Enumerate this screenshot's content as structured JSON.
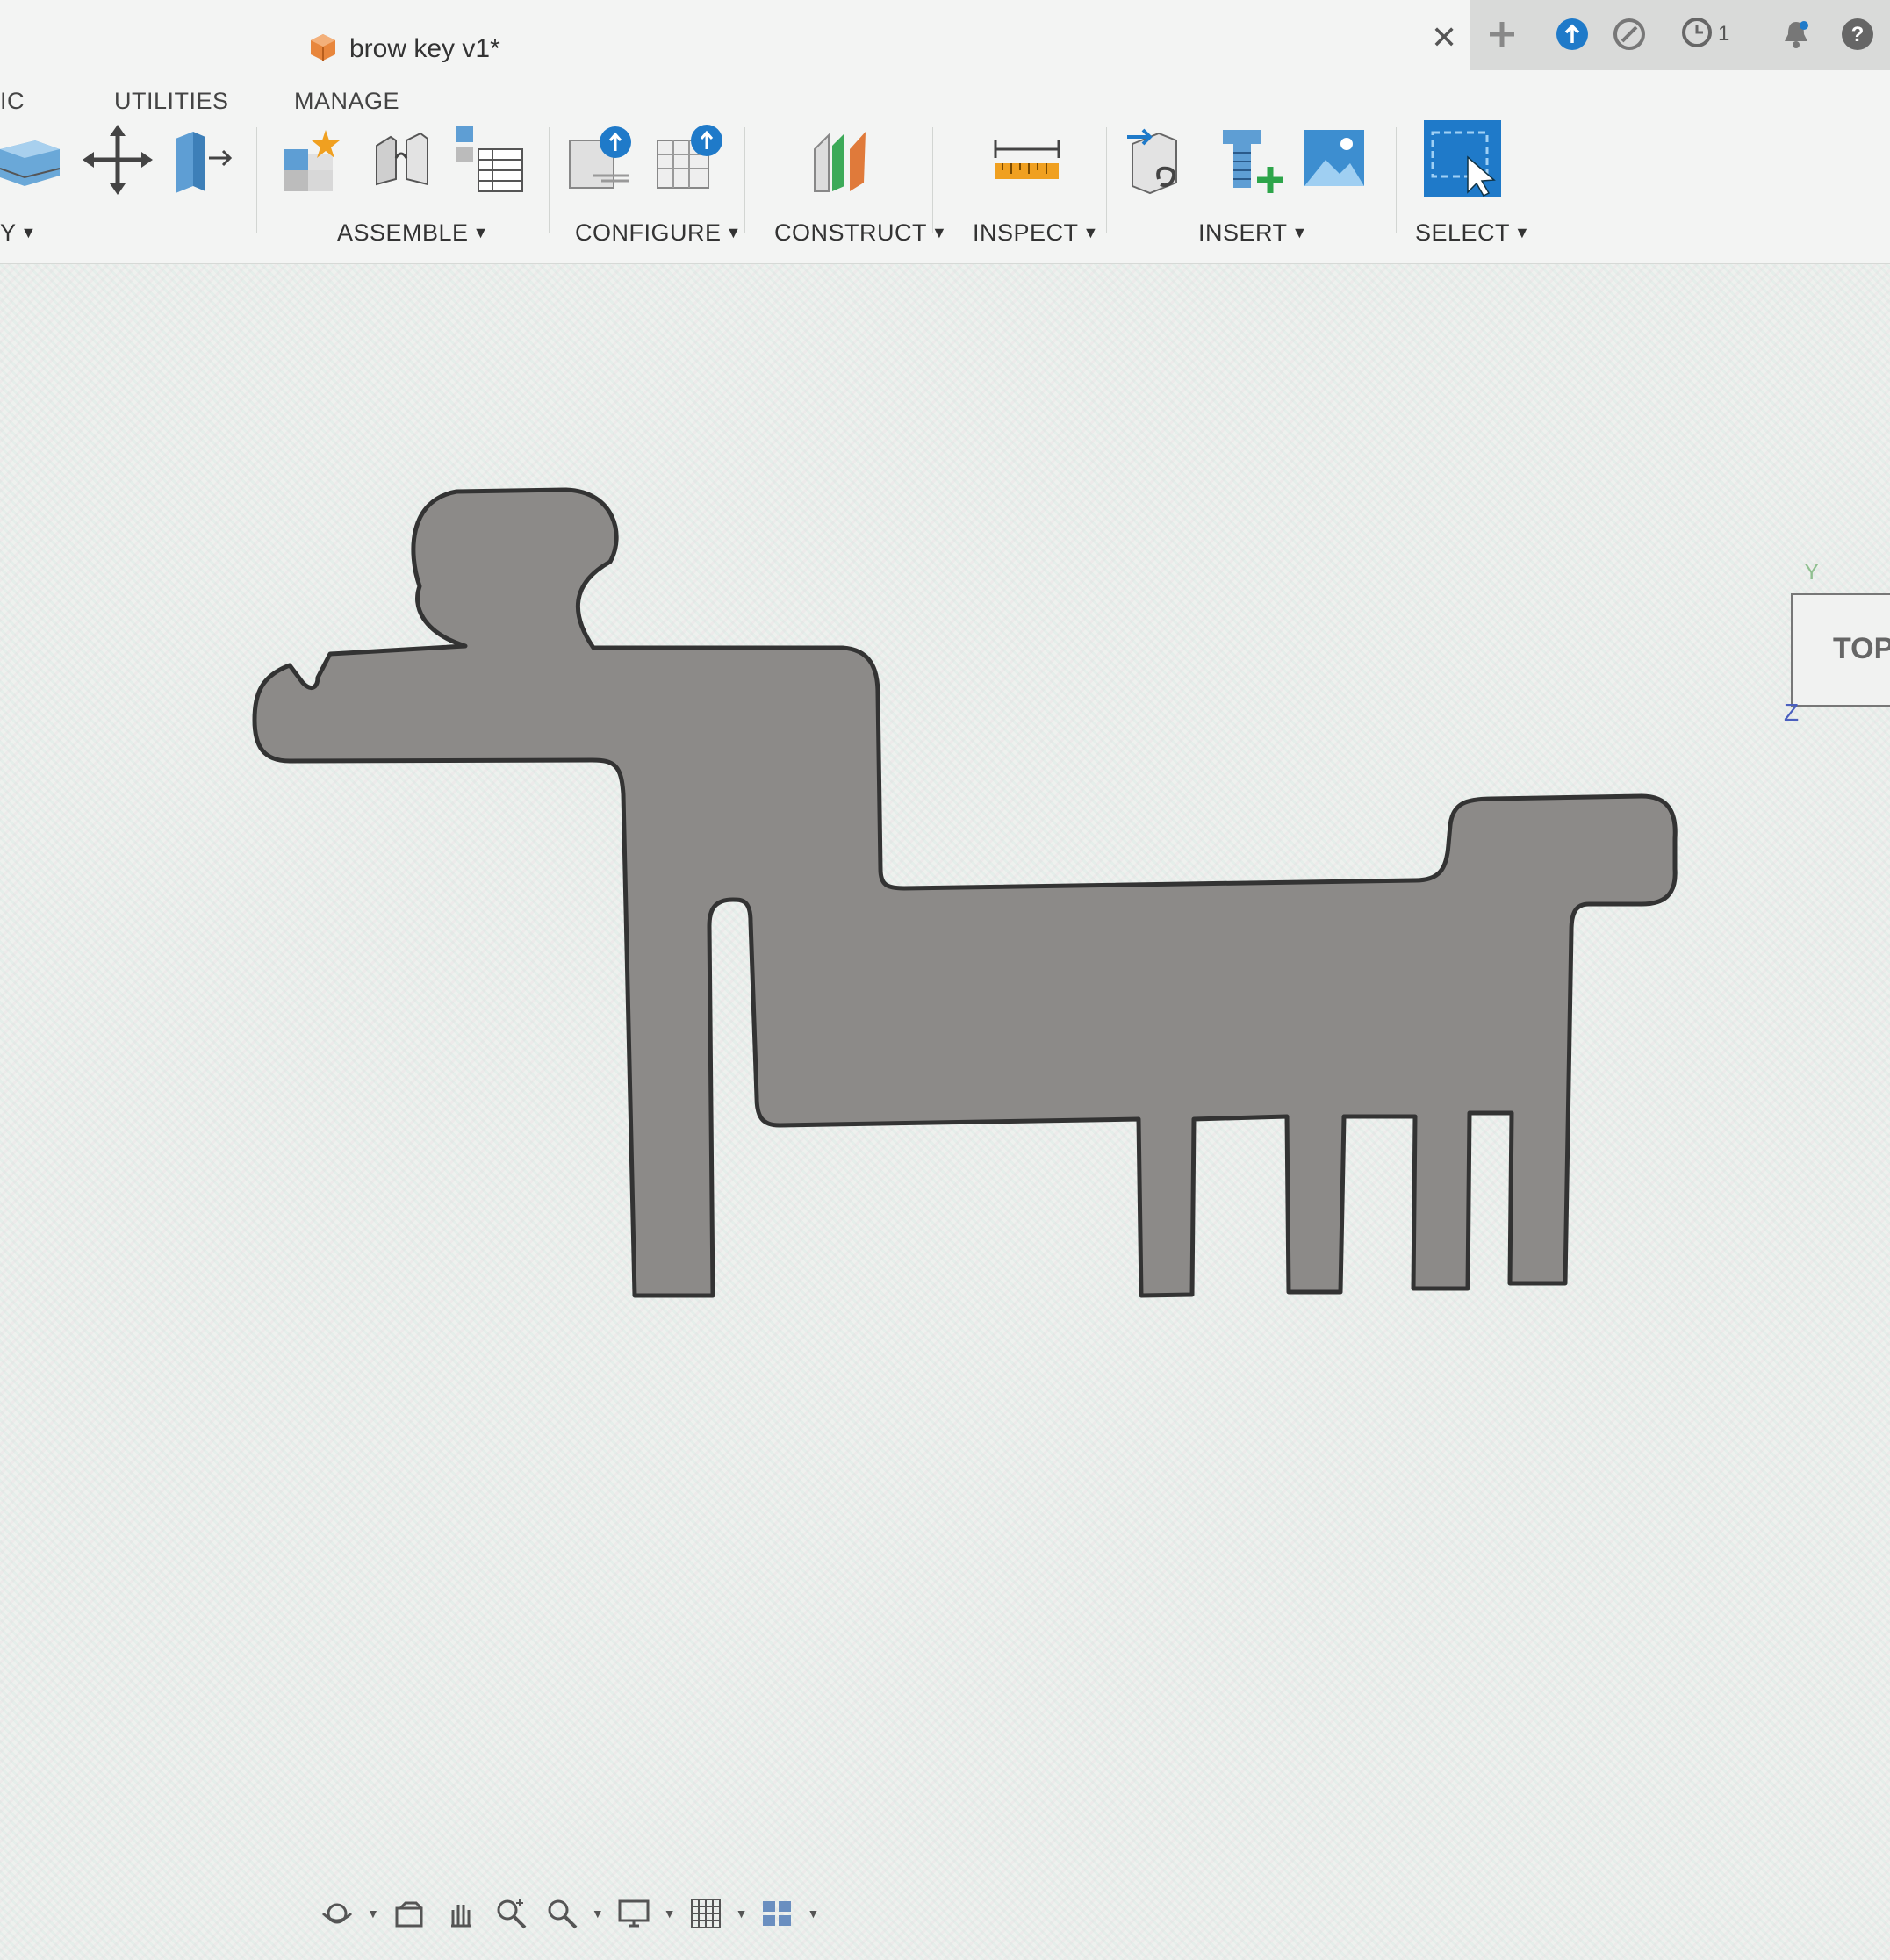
{
  "document": {
    "title": "brow key v1*"
  },
  "toolbar": {
    "menus": [
      "IC",
      "UTILITIES",
      "MANAGE"
    ],
    "partial_group_label": "Y",
    "groups": {
      "assemble": "ASSEMBLE",
      "configure": "CONFIGURE",
      "construct": "CONSTRUCT",
      "inspect": "INSPECT",
      "insert": "INSERT",
      "select": "SELECT"
    }
  },
  "top_bar": {
    "job_count": "1"
  },
  "viewcube": {
    "face": "TOP",
    "axis_y": "Y",
    "axis_z": "Z"
  },
  "colors": {
    "accent": "#1f7ac9",
    "sketch_fill": "#8c8a88",
    "sketch_outline": "#333333"
  },
  "icons": [
    "package-icon",
    "close-icon",
    "plus-icon",
    "upload-icon",
    "extensions-icon",
    "clock-icon",
    "bell-icon",
    "help-icon",
    "box-icon",
    "move-icon",
    "align-icon",
    "new-component-icon",
    "joint-icon",
    "bom-table-icon",
    "configure-icon",
    "configure-table-icon",
    "construct-plane-icon",
    "measure-icon",
    "insert-derive-icon",
    "insert-mcmaster-icon",
    "insert-canvas-icon",
    "select-icon",
    "orbit-icon",
    "look-at-icon",
    "pan-icon",
    "zoom-icon",
    "fit-icon",
    "display-settings-icon",
    "grid-icon",
    "viewports-icon"
  ]
}
